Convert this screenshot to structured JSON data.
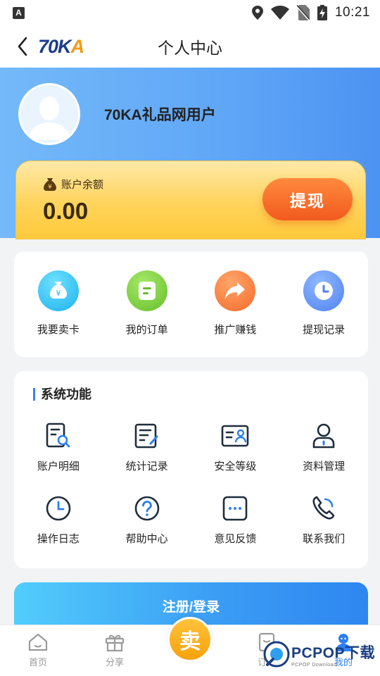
{
  "status_bar": {
    "time": "10:21",
    "left_badge": "A"
  },
  "nav": {
    "logo_part1": "70K",
    "logo_part2": "A",
    "title": "个人中心"
  },
  "profile": {
    "username": "70KA礼品网用户"
  },
  "balance": {
    "label": "账户余额",
    "value": "0.00",
    "withdraw_label": "提现"
  },
  "quick_actions": [
    {
      "label": "我要卖卡",
      "icon": "money-bag-icon",
      "color": "#2fc6f2"
    },
    {
      "label": "我的订单",
      "icon": "order-icon",
      "color": "#7ccf3a"
    },
    {
      "label": "推广赚钱",
      "icon": "share-arrow-icon",
      "color": "#fb7c3b"
    },
    {
      "label": "提现记录",
      "icon": "clock-icon",
      "color": "#5c8ff2"
    }
  ],
  "system": {
    "title": "系统功能",
    "items": [
      {
        "label": "账户明细",
        "icon": "account-detail-icon"
      },
      {
        "label": "统计记录",
        "icon": "statistics-icon"
      },
      {
        "label": "安全等级",
        "icon": "security-card-icon"
      },
      {
        "label": "资料管理",
        "icon": "profile-icon"
      },
      {
        "label": "操作日志",
        "icon": "clock-icon"
      },
      {
        "label": "帮助中心",
        "icon": "help-icon"
      },
      {
        "label": "意见反馈",
        "icon": "feedback-icon"
      },
      {
        "label": "联系我们",
        "icon": "phone-icon"
      }
    ]
  },
  "register": {
    "label": "注册/登录"
  },
  "tabs": [
    {
      "label": "首页",
      "icon": "home-icon"
    },
    {
      "label": "分享",
      "icon": "gift-icon"
    },
    {
      "label": "卖",
      "icon": "sell-button"
    },
    {
      "label": "订单",
      "icon": "order-tab-icon"
    },
    {
      "label": "我的",
      "icon": "user-icon"
    }
  ],
  "watermark": {
    "main": "PCPOP下载",
    "sub": "PCPOP Download"
  },
  "colors": {
    "accent": "#2d7ff2",
    "header_blue": "#5fa6f7",
    "balance_gold": "#ffd45c",
    "withdraw_orange": "#f25a1e",
    "sell_gold": "#f7a20a"
  }
}
